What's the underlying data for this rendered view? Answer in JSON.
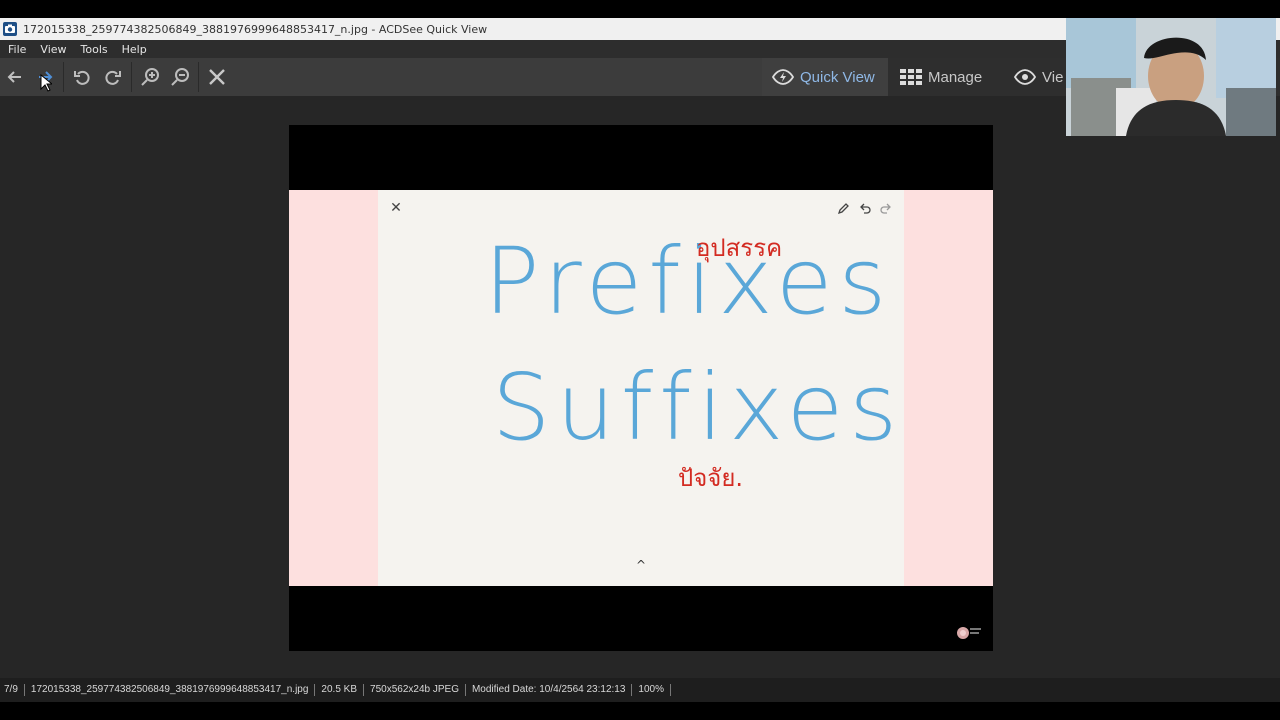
{
  "window": {
    "title": "172015338_259774382506849_3881976999648853417_n.jpg - ACDSee Quick View",
    "app_icon": "camera-icon"
  },
  "menu": {
    "items": [
      "File",
      "View",
      "Tools",
      "Help"
    ]
  },
  "toolbar": {
    "buttons": [
      "back-arrow-icon",
      "forward-arrow-icon",
      "rotate-left-icon",
      "rotate-right-icon",
      "zoom-in-icon",
      "zoom-out-icon",
      "close-icon"
    ],
    "modes": [
      {
        "label": "Quick View",
        "icon": "eye-bolt-icon",
        "active": true
      },
      {
        "label": "Manage",
        "icon": "grid-icon",
        "active": false
      },
      {
        "label": "Vie",
        "icon": "eye-icon",
        "active": false
      }
    ]
  },
  "image": {
    "word_top": "Prefixes",
    "word_bottom": "Suffixes",
    "thai_top": "อุปสรรค",
    "thai_bottom": "ปัจจัย.",
    "ink_blue": "#5aa7d8",
    "ink_red": "#d32b22",
    "slide_bg": "#fde0df",
    "paper_bg": "#f5f3ef"
  },
  "status": {
    "position": "7/9",
    "filename": "172015338_259774382506849_3881976999648853417_n.jpg",
    "size": "20.5 KB",
    "dimensions": "750x562x24b JPEG",
    "modified": "Modified Date: 10/4/2564 23:12:13",
    "zoom": "100%"
  },
  "colors": {
    "accent": "#8fb8e6",
    "toolbar_bg": "#3c3c3c",
    "main_bg": "#262626"
  }
}
